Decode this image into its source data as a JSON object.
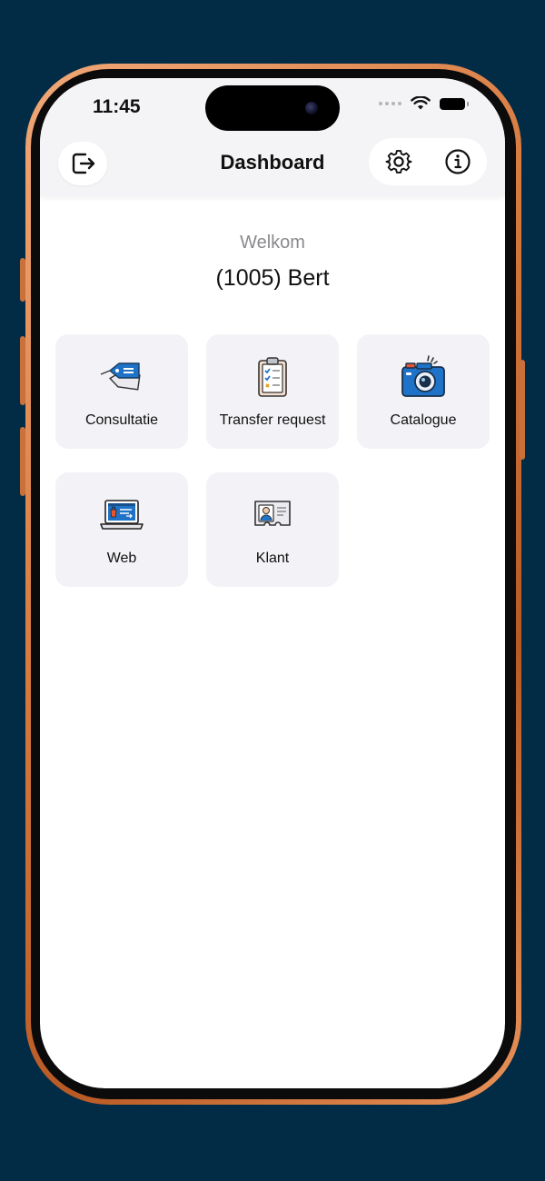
{
  "status_bar": {
    "time": "11:45"
  },
  "nav": {
    "title": "Dashboard"
  },
  "greeting": {
    "welcome": "Welkom",
    "user": "(1005) Bert"
  },
  "tiles": [
    {
      "label": "Consultatie",
      "icon": "price-tag-icon"
    },
    {
      "label": "Transfer request",
      "icon": "clipboard-checklist-icon"
    },
    {
      "label": "Catalogue",
      "icon": "camera-icon"
    },
    {
      "label": "Web",
      "icon": "laptop-shop-icon"
    },
    {
      "label": "Klant",
      "icon": "id-card-icon"
    }
  ],
  "colors": {
    "background": "#022b45",
    "frame": "#d77a3f",
    "tile_bg": "#f3f3f7",
    "icon_blue": "#1e73c8"
  }
}
